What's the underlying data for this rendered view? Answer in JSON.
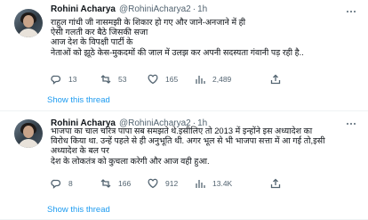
{
  "tweets": [
    {
      "name": "Rohini Acharya",
      "handle": "@RohiniAcharya2",
      "separator": "·",
      "time": "1h",
      "lines": [
        "राहुल गांधी जी नासमझी के शिकार हो गए और जाने-अनजाने में ही",
        "ऐसी गलती कर बैठे जिसकी सजा",
        "आज देश के विपक्षी पार्टी के",
        "नेताओं को झूठे केस-मुकदमों की जाल में उलझ कर अपनी सदस्यता गंवानी पड़ रही है.."
      ],
      "stats": {
        "replies": "13",
        "retweets": "53",
        "likes": "165",
        "views": "2,489"
      },
      "show_thread": "Show this thread"
    },
    {
      "name": "Rohini Acharya",
      "handle": "@RohiniAcharya2",
      "separator": "·",
      "time": "1h",
      "lines": [
        "भाजपा का चाल चरित्र पापा सब समझते थे.इसीलिए तो 2013 में इन्होंने इस अध्यादेश का",
        "विरोध किया था. उन्हें पहले से ही अनुभूति थी. अगर भूल से भी भाजपा सत्ता में आ गई तो,इसी",
        "अध्यादेश के बल पर",
        "देश के लोकतंत्र को कुचला करेगी और आज वही हुआ."
      ],
      "stats": {
        "replies": "8",
        "retweets": "166",
        "likes": "912",
        "views": "13.4K"
      },
      "show_thread": "Show this thread"
    }
  ],
  "colors": {
    "link": "#1d9bf0",
    "muted": "#536471",
    "text": "#0f1419",
    "divider": "#eff3f4"
  },
  "icons": [
    "reply-icon",
    "retweet-icon",
    "like-icon",
    "views-icon",
    "share-icon",
    "more-icon"
  ]
}
